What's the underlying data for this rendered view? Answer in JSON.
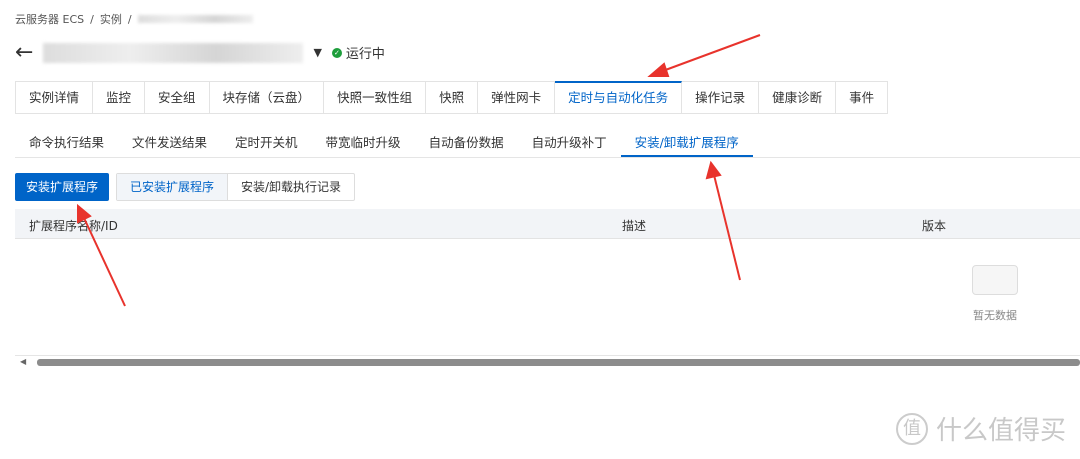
{
  "breadcrumb": {
    "items": [
      "云服务器 ECS",
      "实例"
    ],
    "sep": "/"
  },
  "header": {
    "back": "←",
    "status": "运行中",
    "status_color": "#1e9e3c"
  },
  "tabs": [
    "实例详情",
    "监控",
    "安全组",
    "块存储（云盘）",
    "快照一致性组",
    "快照",
    "弹性网卡",
    "定时与自动化任务",
    "操作记录",
    "健康诊断",
    "事件"
  ],
  "subtabs": [
    "命令执行结果",
    "文件发送结果",
    "定时开关机",
    "带宽临时升级",
    "自动备份数据",
    "自动升级补丁",
    "安装/卸载扩展程序"
  ],
  "toolbar": {
    "install": "安装扩展程序",
    "installed": "已安装扩展程序",
    "records": "安装/卸载执行记录"
  },
  "table": {
    "columns": [
      "扩展程序名称/ID",
      "描述",
      "版本"
    ],
    "empty": "暂无数据"
  },
  "watermark": {
    "logo": "值",
    "text": "什么值得买"
  },
  "accent": "#0064c8"
}
